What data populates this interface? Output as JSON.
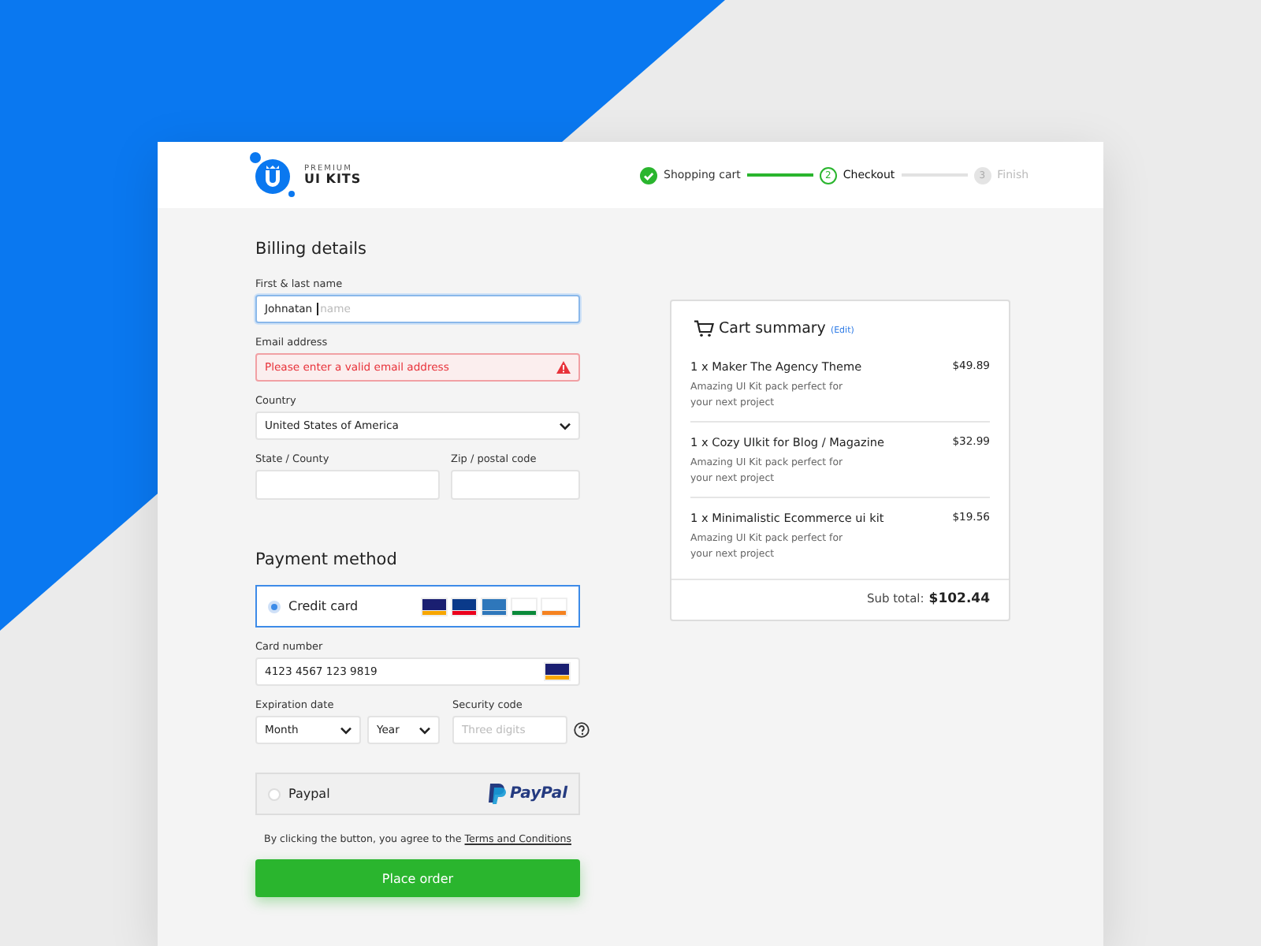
{
  "logo": {
    "small": "PREMIUM",
    "large": "UI KITS"
  },
  "steps": [
    {
      "label": "Shopping cart",
      "completed": true,
      "selected": false
    },
    {
      "number": "2",
      "label": "Checkout",
      "completed": false,
      "selected": true
    },
    {
      "number": "3",
      "label": "Finish",
      "completed": false,
      "selected": false
    }
  ],
  "billing": {
    "title": "Billing details",
    "name": {
      "label": "First & last name",
      "value": "Johnatan",
      "hint": "name",
      "focused": true
    },
    "email": {
      "label": "Email address",
      "error": "Please enter a valid email address"
    },
    "country": {
      "label": "Country",
      "value": "United States of America"
    },
    "state": {
      "label": "State / County"
    },
    "zip": {
      "label": "Zip / postal code"
    }
  },
  "payment": {
    "title": "Payment method",
    "options": [
      {
        "kind": "card",
        "label": "Credit card",
        "selected": true
      },
      {
        "kind": "paypal",
        "label": "Paypal",
        "logo": "PayPal",
        "selected": false
      }
    ],
    "card_number": {
      "label": "Card number",
      "value": "4123 4567 123 9819"
    },
    "expiration": {
      "label": "Expiration date",
      "month": "Month",
      "year": "Year"
    },
    "security": {
      "label": "Security code",
      "placeholder": "Three digits"
    }
  },
  "agreement": {
    "text": "By clicking the button, you agree to the",
    "link": "Terms and Conditions"
  },
  "place_order": "Place order",
  "cart": {
    "title": "Cart summary",
    "edit": "(Edit)",
    "items": [
      {
        "name": "1 x Maker The Agency Theme",
        "price": "$49.89",
        "description": "Amazing UI Kit pack perfect for your next project"
      },
      {
        "name": "1 x Cozy UIkit for Blog / Magazine",
        "price": "$32.99",
        "description": "Amazing UI Kit pack perfect for your next project"
      },
      {
        "name": "1 x Minimalistic Ecommerce ui kit",
        "price": "$19.56",
        "description": "Amazing UI Kit pack perfect for your next project"
      }
    ],
    "subtotal_label": "Sub total:",
    "subtotal": "$102.44"
  }
}
